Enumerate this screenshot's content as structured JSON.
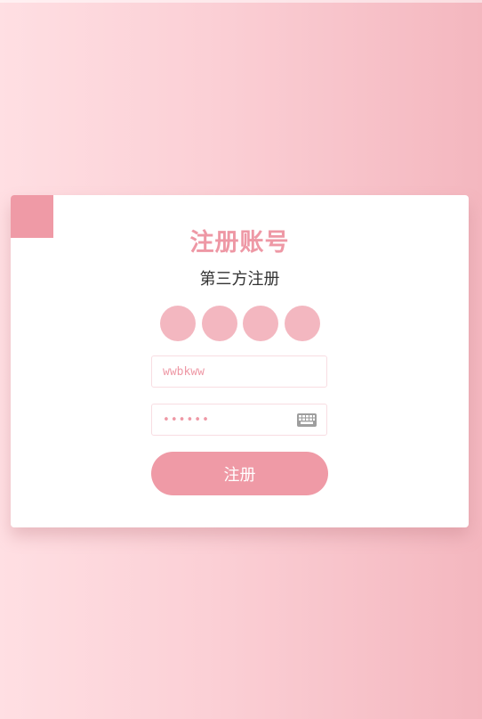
{
  "form": {
    "title": "注册账号",
    "subtitle": "第三方注册",
    "username": {
      "value": "wwbkww",
      "placeholder": ""
    },
    "password": {
      "value": "wwbkww",
      "placeholder": ""
    },
    "submit_label": "注册"
  },
  "icons": {
    "keyboard": "keyboard-icon",
    "social": [
      "social-login-icon",
      "social-login-icon",
      "social-login-icon",
      "social-login-icon"
    ]
  },
  "colors": {
    "accent": "#ef9aa6",
    "social_circle": "#f3b7c0",
    "background_left": "#ffdfe3",
    "background_right": "#f4b7bf",
    "card": "#ffffff"
  }
}
